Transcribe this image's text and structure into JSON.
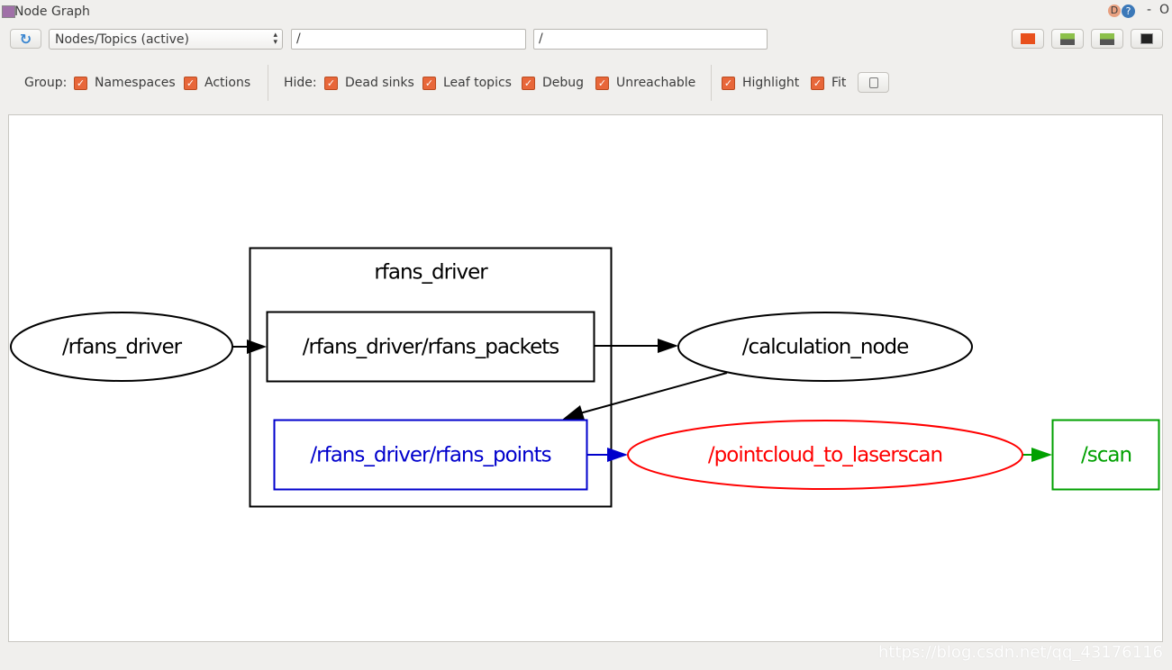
{
  "window": {
    "title": "Node Graph",
    "controls": [
      "D",
      "?",
      "-",
      "O"
    ]
  },
  "toolbar": {
    "mode_select": "Nodes/Topics (active)",
    "filter_1": "/",
    "filter_2": "/"
  },
  "options": {
    "group_label": "Group:",
    "group": [
      {
        "label": "Namespaces",
        "checked": true
      },
      {
        "label": "Actions",
        "checked": true
      }
    ],
    "hide_label": "Hide:",
    "hide": [
      {
        "label": "Dead sinks",
        "checked": true
      },
      {
        "label": "Leaf topics",
        "checked": true
      },
      {
        "label": "Debug",
        "checked": true
      },
      {
        "label": "Unreachable",
        "checked": true
      }
    ],
    "view": [
      {
        "label": "Highlight",
        "checked": true
      },
      {
        "label": "Fit",
        "checked": true
      }
    ]
  },
  "graph": {
    "cluster": "rfans_driver",
    "nodes": {
      "rfans_driver": "/rfans_driver",
      "packets": "/rfans_driver/rfans_packets",
      "calc": "/calculation_node",
      "points": "/rfans_driver/rfans_points",
      "pc2ls": "/pointcloud_to_laserscan",
      "scan": "/scan"
    },
    "colors": {
      "default": "#000000",
      "blue": "#0000cc",
      "red": "#ff0000",
      "green": "#00a000"
    }
  },
  "watermark": "https://blog.csdn.net/qq_43176116"
}
